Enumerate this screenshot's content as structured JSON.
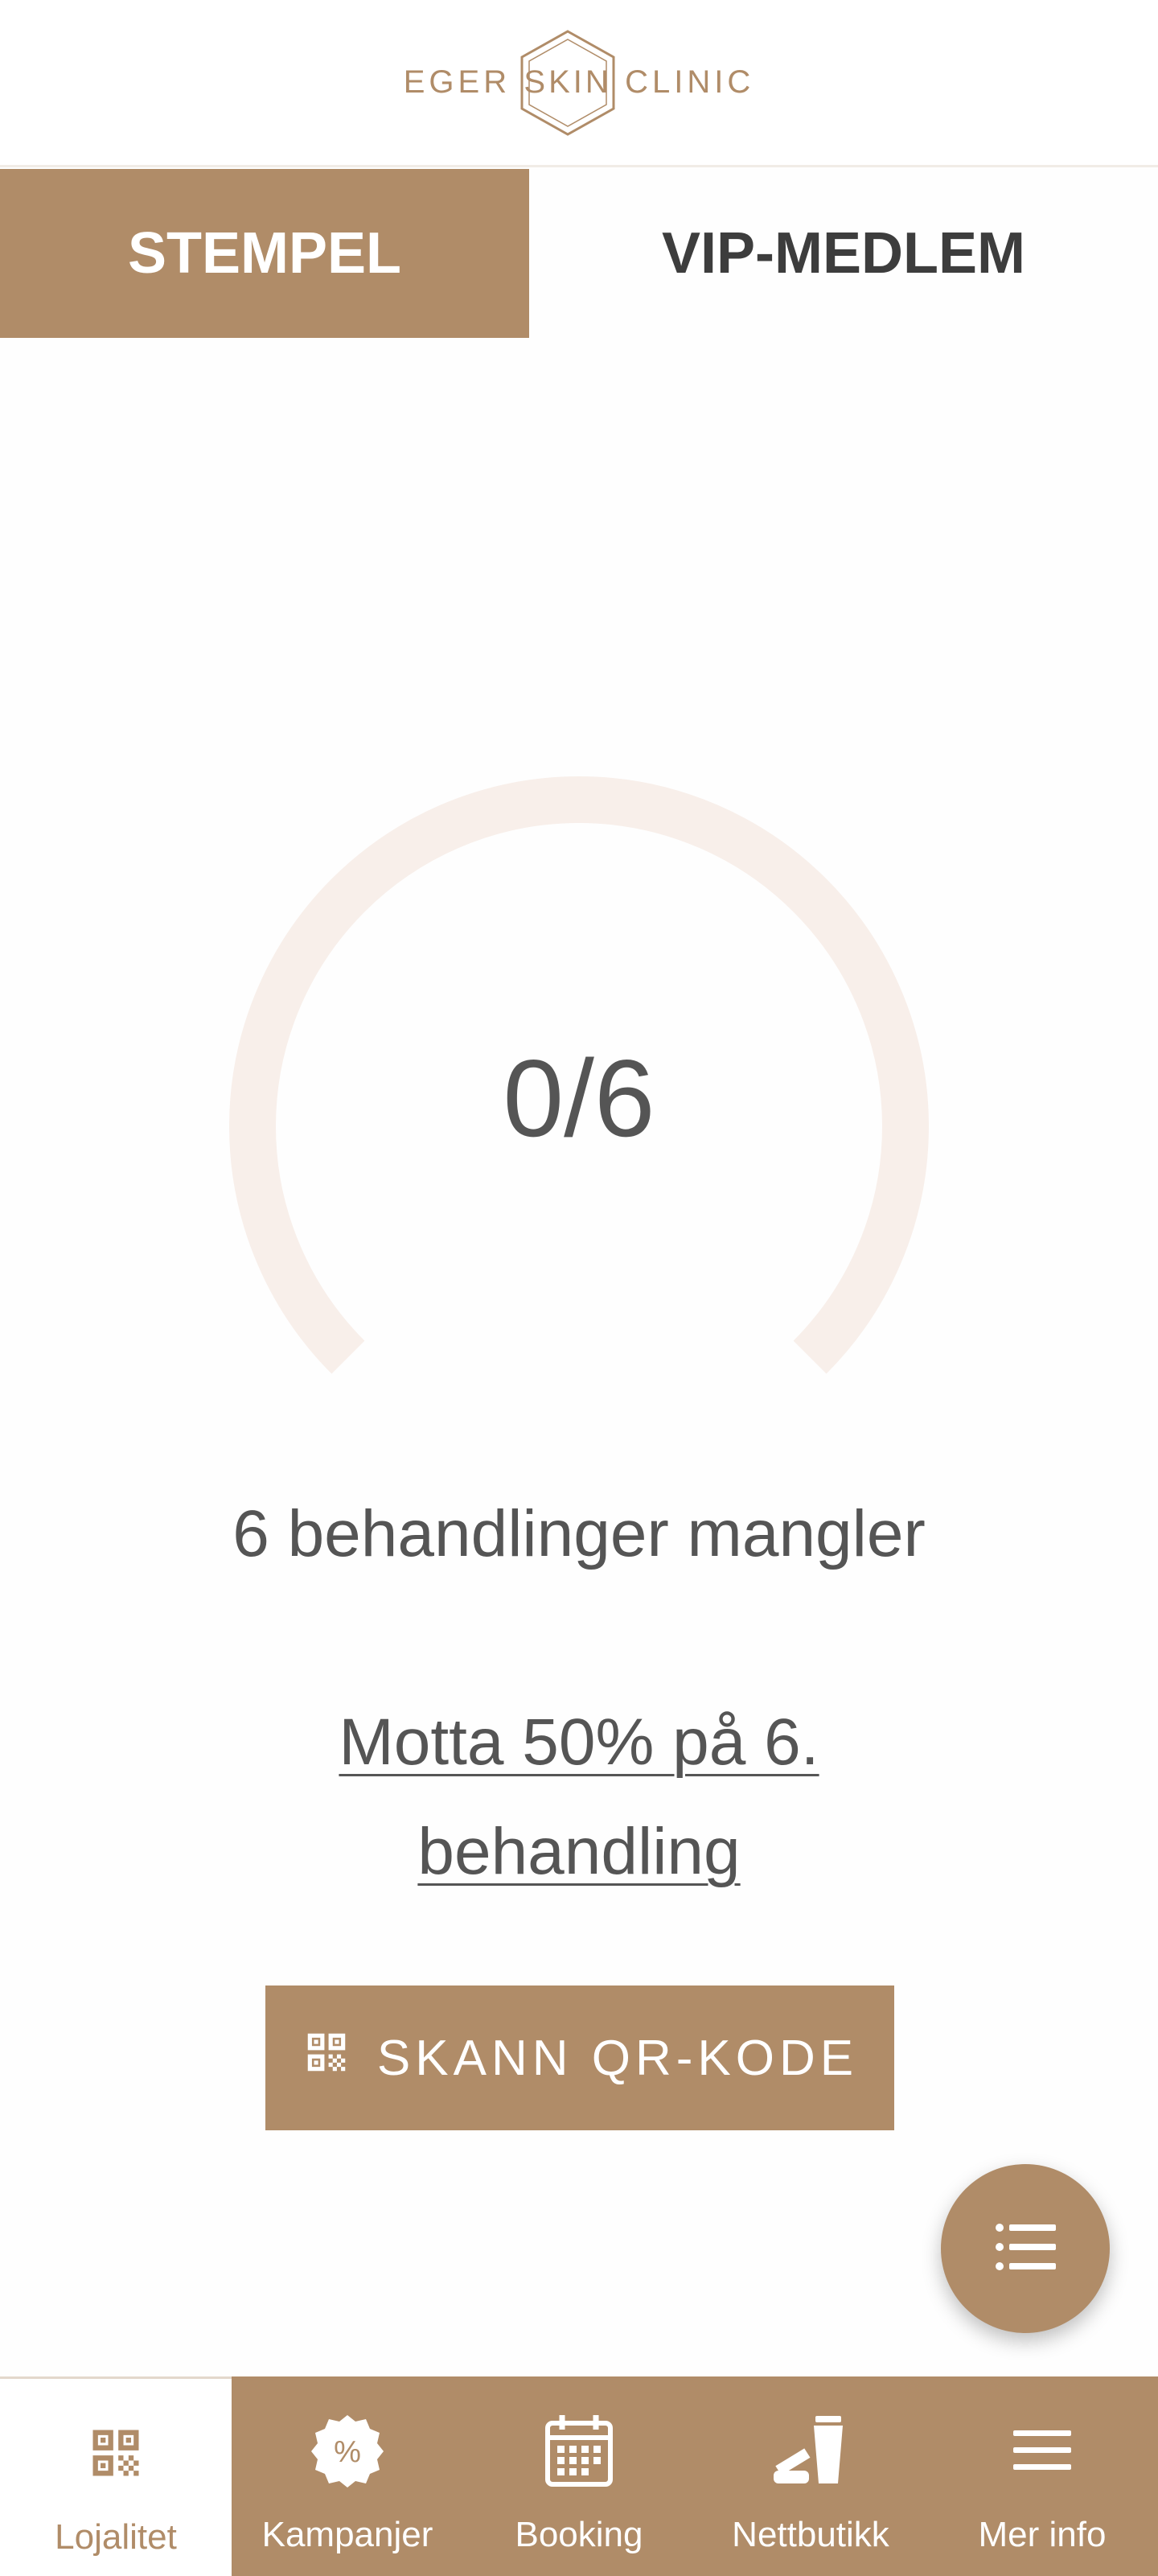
{
  "brand": {
    "left": "EGER",
    "center": "SKIN",
    "right": "CLINIC",
    "color": "#b08c68"
  },
  "tabs": [
    {
      "label": "STEMPEL",
      "active": true
    },
    {
      "label": "VIP-MEDLEM",
      "active": false
    }
  ],
  "stamp": {
    "progress": "0/6",
    "collected": 0,
    "total": 6,
    "remaining_text": "6 behandlinger mangler",
    "offer_text": "Motta 50% på 6. behandling"
  },
  "scan_button": {
    "label": "SKANN QR-KODE",
    "icon": "qr-code-icon"
  },
  "fab": {
    "icon": "list-icon"
  },
  "bottom_nav": [
    {
      "label": "Lojalitet",
      "icon": "qr-code-icon",
      "active": true
    },
    {
      "label": "Kampanjer",
      "icon": "percent-badge-icon",
      "active": false
    },
    {
      "label": "Booking",
      "icon": "calendar-icon",
      "active": false
    },
    {
      "label": "Nettbutikk",
      "icon": "cosmetics-icon",
      "active": false
    },
    {
      "label": "Mer info",
      "icon": "menu-icon",
      "active": false
    }
  ],
  "colors": {
    "accent": "#b08c68",
    "ring_track": "#f8efea",
    "text": "#555555"
  }
}
